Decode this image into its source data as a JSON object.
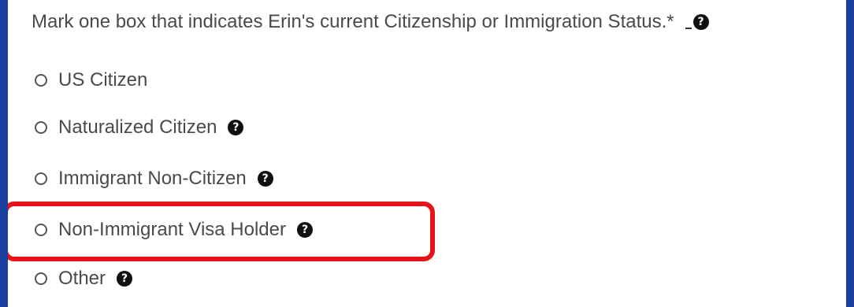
{
  "question": {
    "text": "Mark one box that indicates Erin's current Citizenship or Immigration Status.*",
    "help_glyph": "?"
  },
  "options": [
    {
      "label": "US Citizen",
      "has_help": false
    },
    {
      "label": "Naturalized Citizen",
      "has_help": true
    },
    {
      "label": "Immigrant Non-Citizen",
      "has_help": true
    },
    {
      "label": "Non-Immigrant Visa Holder",
      "has_help": true,
      "highlighted": true
    },
    {
      "label": "Other",
      "has_help": true
    }
  ],
  "icons": {
    "help": "question-circle-icon",
    "radio": "radio-unchecked-icon"
  },
  "colors": {
    "page_border": "#1b3f9c",
    "highlight": "#e8121b",
    "text": "#4a4a4a"
  }
}
